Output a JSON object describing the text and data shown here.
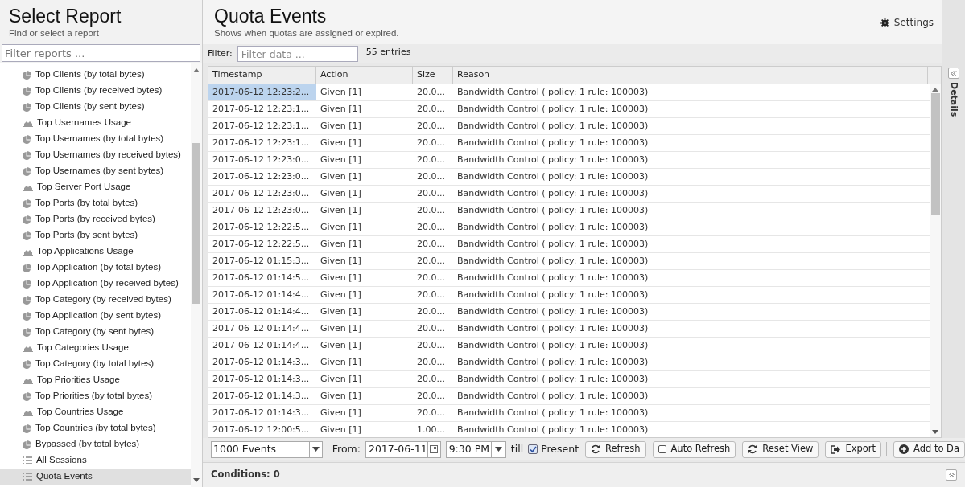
{
  "sidebar": {
    "title": "Select Report",
    "subtitle": "Find or select a report",
    "search": {
      "placeholder": "Filter reports ..."
    },
    "items": [
      {
        "kind": "pie",
        "label": "Top Clients (by total bytes)",
        "selected": false
      },
      {
        "kind": "pie",
        "label": "Top Clients (by received bytes)",
        "selected": false
      },
      {
        "kind": "pie",
        "label": "Top Clients (by sent bytes)",
        "selected": false
      },
      {
        "kind": "area",
        "label": "Top Usernames Usage",
        "selected": false
      },
      {
        "kind": "pie",
        "label": "Top Usernames (by total bytes)",
        "selected": false
      },
      {
        "kind": "pie",
        "label": "Top Usernames (by received bytes)",
        "selected": false
      },
      {
        "kind": "pie",
        "label": "Top Usernames (by sent bytes)",
        "selected": false
      },
      {
        "kind": "area",
        "label": "Top Server Port Usage",
        "selected": false
      },
      {
        "kind": "pie",
        "label": "Top Ports (by total bytes)",
        "selected": false
      },
      {
        "kind": "pie",
        "label": "Top Ports (by received bytes)",
        "selected": false
      },
      {
        "kind": "pie",
        "label": "Top Ports (by sent bytes)",
        "selected": false
      },
      {
        "kind": "area",
        "label": "Top Applications Usage",
        "selected": false
      },
      {
        "kind": "pie",
        "label": "Top Application (by total bytes)",
        "selected": false
      },
      {
        "kind": "pie",
        "label": "Top Application (by received bytes)",
        "selected": false
      },
      {
        "kind": "pie",
        "label": "Top Category (by received bytes)",
        "selected": false
      },
      {
        "kind": "pie",
        "label": "Top Application (by sent bytes)",
        "selected": false
      },
      {
        "kind": "pie",
        "label": "Top Category (by sent bytes)",
        "selected": false
      },
      {
        "kind": "area",
        "label": "Top Categories Usage",
        "selected": false
      },
      {
        "kind": "pie",
        "label": "Top Category (by total bytes)",
        "selected": false
      },
      {
        "kind": "area",
        "label": "Top Priorities Usage",
        "selected": false
      },
      {
        "kind": "pie",
        "label": "Top Priorities (by total bytes)",
        "selected": false
      },
      {
        "kind": "area",
        "label": "Top Countries Usage",
        "selected": false
      },
      {
        "kind": "pie",
        "label": "Top Countries (by total bytes)",
        "selected": false
      },
      {
        "kind": "pie",
        "label": "Bypassed (by total bytes)",
        "selected": false
      },
      {
        "kind": "list",
        "label": "All Sessions",
        "selected": false
      },
      {
        "kind": "list",
        "label": "Quota Events",
        "selected": true
      }
    ]
  },
  "header": {
    "title": "Quota Events",
    "subtitle": "Shows when quotas are assigned or expired.",
    "settings": "Settings"
  },
  "filter_bar": {
    "label": "Filter:",
    "placeholder": "Filter data ...",
    "count": "55 entries"
  },
  "table": {
    "columns": [
      "Timestamp",
      "Action",
      "Size",
      "Reason"
    ],
    "rows": [
      {
        "cells": [
          "2017-06-12 12:23:2...",
          "Given [1]",
          "20.0...",
          "Bandwidth Control ( policy: 1 rule: 100003)"
        ],
        "selected": true
      },
      {
        "cells": [
          "2017-06-12 12:23:1...",
          "Given [1]",
          "20.0...",
          "Bandwidth Control ( policy: 1 rule: 100003)"
        ],
        "selected": false
      },
      {
        "cells": [
          "2017-06-12 12:23:1...",
          "Given [1]",
          "20.0...",
          "Bandwidth Control ( policy: 1 rule: 100003)"
        ],
        "selected": false
      },
      {
        "cells": [
          "2017-06-12 12:23:1...",
          "Given [1]",
          "20.0...",
          "Bandwidth Control ( policy: 1 rule: 100003)"
        ],
        "selected": false
      },
      {
        "cells": [
          "2017-06-12 12:23:0...",
          "Given [1]",
          "20.0...",
          "Bandwidth Control ( policy: 1 rule: 100003)"
        ],
        "selected": false
      },
      {
        "cells": [
          "2017-06-12 12:23:0...",
          "Given [1]",
          "20.0...",
          "Bandwidth Control ( policy: 1 rule: 100003)"
        ],
        "selected": false
      },
      {
        "cells": [
          "2017-06-12 12:23:0...",
          "Given [1]",
          "20.0...",
          "Bandwidth Control ( policy: 1 rule: 100003)"
        ],
        "selected": false
      },
      {
        "cells": [
          "2017-06-12 12:23:0...",
          "Given [1]",
          "20.0...",
          "Bandwidth Control ( policy: 1 rule: 100003)"
        ],
        "selected": false
      },
      {
        "cells": [
          "2017-06-12 12:22:5...",
          "Given [1]",
          "20.0...",
          "Bandwidth Control ( policy: 1 rule: 100003)"
        ],
        "selected": false
      },
      {
        "cells": [
          "2017-06-12 12:22:5...",
          "Given [1]",
          "20.0...",
          "Bandwidth Control ( policy: 1 rule: 100003)"
        ],
        "selected": false
      },
      {
        "cells": [
          "2017-06-12 01:15:3...",
          "Given [1]",
          "20.0...",
          "Bandwidth Control ( policy: 1 rule: 100003)"
        ],
        "selected": false
      },
      {
        "cells": [
          "2017-06-12 01:14:5...",
          "Given [1]",
          "20.0...",
          "Bandwidth Control ( policy: 1 rule: 100003)"
        ],
        "selected": false
      },
      {
        "cells": [
          "2017-06-12 01:14:4...",
          "Given [1]",
          "20.0...",
          "Bandwidth Control ( policy: 1 rule: 100003)"
        ],
        "selected": false
      },
      {
        "cells": [
          "2017-06-12 01:14:4...",
          "Given [1]",
          "20.0...",
          "Bandwidth Control ( policy: 1 rule: 100003)"
        ],
        "selected": false
      },
      {
        "cells": [
          "2017-06-12 01:14:4...",
          "Given [1]",
          "20.0...",
          "Bandwidth Control ( policy: 1 rule: 100003)"
        ],
        "selected": false
      },
      {
        "cells": [
          "2017-06-12 01:14:4...",
          "Given [1]",
          "20.0...",
          "Bandwidth Control ( policy: 1 rule: 100003)"
        ],
        "selected": false
      },
      {
        "cells": [
          "2017-06-12 01:14:3...",
          "Given [1]",
          "20.0...",
          "Bandwidth Control ( policy: 1 rule: 100003)"
        ],
        "selected": false
      },
      {
        "cells": [
          "2017-06-12 01:14:3...",
          "Given [1]",
          "20.0...",
          "Bandwidth Control ( policy: 1 rule: 100003)"
        ],
        "selected": false
      },
      {
        "cells": [
          "2017-06-12 01:14:3...",
          "Given [1]",
          "20.0...",
          "Bandwidth Control ( policy: 1 rule: 100003)"
        ],
        "selected": false
      },
      {
        "cells": [
          "2017-06-12 01:14:3...",
          "Given [1]",
          "20.0...",
          "Bandwidth Control ( policy: 1 rule: 100003)"
        ],
        "selected": false
      },
      {
        "cells": [
          "2017-06-12 12:00:5...",
          "Given [1]",
          "1.00...",
          "Bandwidth Control ( policy: 1 rule: 100003)"
        ],
        "selected": false
      }
    ]
  },
  "toolbar": {
    "limit": "1000 Events",
    "from_label": "From:",
    "date": "2017-06-11",
    "time": "9:30 PM",
    "till": "till",
    "present": {
      "label": "Present",
      "checked": true
    },
    "buttons": [
      {
        "kind": "refresh",
        "label": "Refresh"
      },
      {
        "kind": "auto",
        "label": "Auto Refresh",
        "checked": false
      },
      {
        "kind": "refresh",
        "label": "Reset View"
      },
      {
        "kind": "export",
        "label": "Export"
      },
      {
        "kind": "add",
        "label": "Add to Da"
      }
    ]
  },
  "conditions": "Conditions: 0",
  "details": "Details"
}
